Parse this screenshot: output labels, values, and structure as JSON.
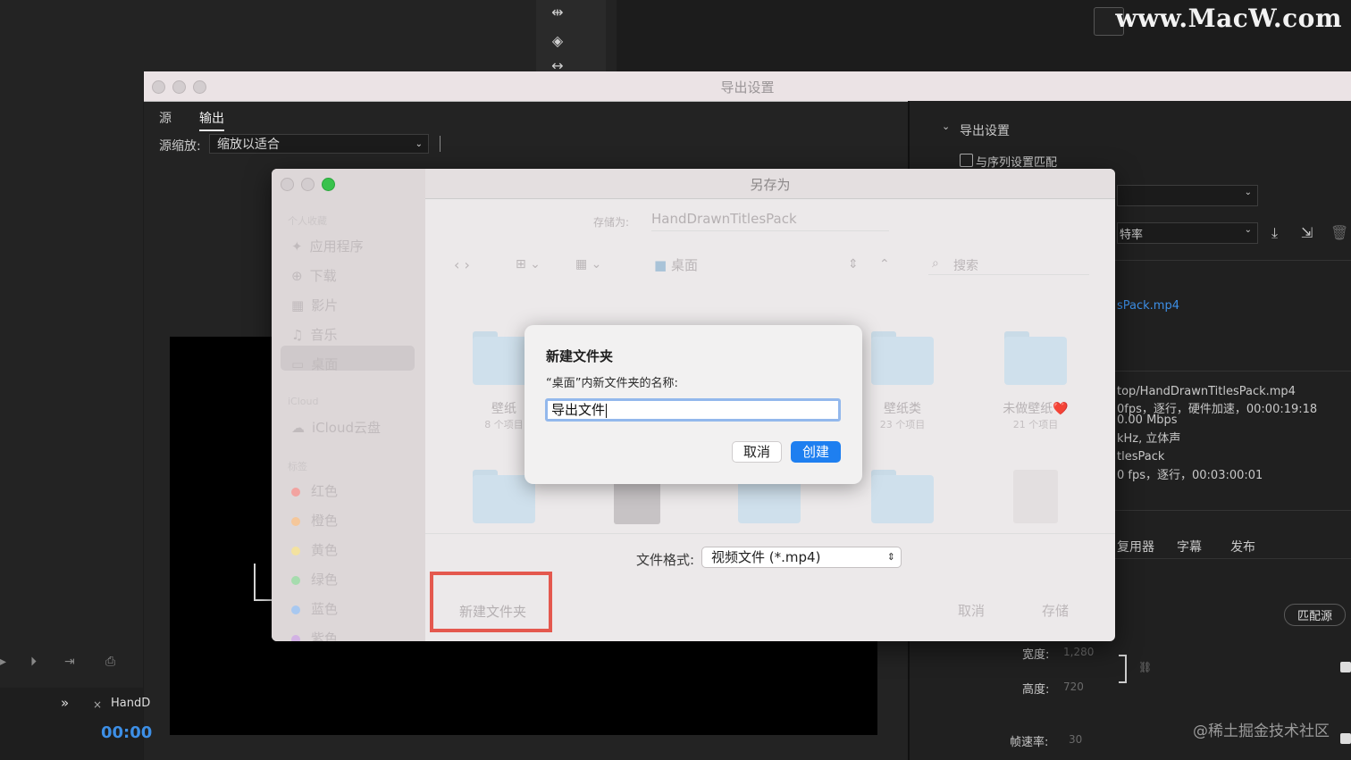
{
  "watermark": {
    "site": "www.MacW.com",
    "bottom": "@稀土掘金技术社区"
  },
  "export_window": {
    "title": "导出设置",
    "tabs": [
      "源",
      "输出"
    ],
    "source_scale_label": "源缩放:",
    "source_scale_value": "缩放以适合",
    "right_panel": {
      "section_title": "导出设置",
      "match_sequence": "与序列设置匹配",
      "bitrate_fragment": "特率",
      "output_file_fragment": "sPack.mp4",
      "summary_lines": [
        "top/HandDrawnTitlesPack.mp4",
        "0fps，逐行，硬件加速，00:00:19:18",
        "0.00 Mbps",
        "kHz, 立体声",
        "tlesPack",
        "0 fps，逐行，00:03:00:01"
      ],
      "tabs": [
        "复用器",
        "字幕",
        "发布"
      ],
      "match_source_button": "匹配源",
      "width_label": "宽度:",
      "width_value": "1,280",
      "height_label": "高度:",
      "height_value": "720",
      "framerate_label": "帧速率:",
      "framerate_value": "30"
    },
    "bottom_left": {
      "tab_label": "HandD",
      "timecode": "00:00"
    }
  },
  "save_as": {
    "title": "另存为",
    "save_as_label": "存储为:",
    "filename": "HandDrawnTitlesPack",
    "location": "桌面",
    "search_placeholder": "搜索",
    "sidebar": {
      "favorites_header": "个人收藏",
      "favorites": [
        "应用程序",
        "下载",
        "影片",
        "音乐",
        "桌面"
      ],
      "icloud_header": "iCloud",
      "icloud": [
        "iCloud云盘"
      ],
      "tags_header": "标签",
      "tags": [
        {
          "name": "红色",
          "color": "#f2a3a0"
        },
        {
          "name": "橙色",
          "color": "#f5c79a"
        },
        {
          "name": "黄色",
          "color": "#f3e2a0"
        },
        {
          "name": "绿色",
          "color": "#a6dcae"
        },
        {
          "name": "蓝色",
          "color": "#a8c8f0"
        },
        {
          "name": "紫色",
          "color": "#d2b2e4"
        }
      ]
    },
    "folders": [
      {
        "name": "壁纸",
        "count": "8 个项目"
      },
      {
        "name": "壁纸类",
        "count": "23 个项目"
      },
      {
        "name": "未做壁纸❤️",
        "count": "21 个项目"
      }
    ],
    "file_format_label": "文件格式:",
    "file_format_value": "视频文件 (*.mp4)",
    "new_folder_button": "新建文件夹",
    "cancel_button": "取消",
    "save_button": "存储"
  },
  "new_folder_dialog": {
    "title": "新建文件夹",
    "prompt": "“桌面”内新文件夹的名称:",
    "value": "导出文件",
    "cancel": "取消",
    "create": "创建"
  }
}
